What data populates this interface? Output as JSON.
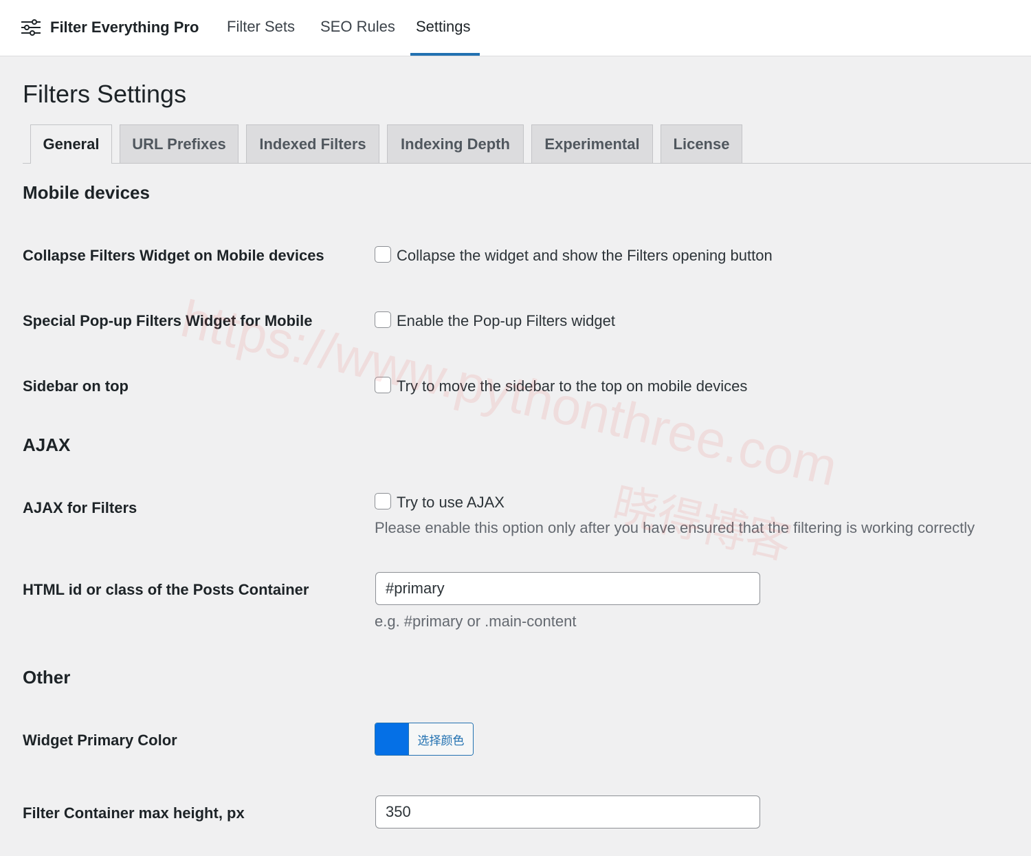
{
  "header": {
    "brand_name": "Filter Everything Pro",
    "brand_icon": "sliders-icon",
    "nav": [
      {
        "label": "Filter Sets",
        "active": false
      },
      {
        "label": "SEO Rules",
        "active": false
      },
      {
        "label": "Settings",
        "active": true
      }
    ],
    "accent_color": "#2271b1"
  },
  "page": {
    "title": "Filters Settings",
    "tabs": [
      {
        "label": "General",
        "active": true
      },
      {
        "label": "URL Prefixes",
        "active": false
      },
      {
        "label": "Indexed Filters",
        "active": false
      },
      {
        "label": "Indexing Depth",
        "active": false
      },
      {
        "label": "Experimental",
        "active": false
      },
      {
        "label": "License",
        "active": false
      }
    ]
  },
  "sections": {
    "mobile": {
      "title": "Mobile devices",
      "collapse": {
        "label": "Collapse Filters Widget on Mobile devices",
        "checkbox_label": "Collapse the widget and show the Filters opening button",
        "checked": false
      },
      "popup": {
        "label": "Special Pop-up Filters Widget for Mobile",
        "checkbox_label": "Enable the Pop-up Filters widget",
        "checked": false
      },
      "sidebar": {
        "label": "Sidebar on top",
        "checkbox_label": "Try to move the sidebar to the top on mobile devices",
        "checked": false
      }
    },
    "ajax": {
      "title": "AJAX",
      "ajax_filters": {
        "label": "AJAX for Filters",
        "checkbox_label": "Try to use AJAX",
        "checked": false,
        "description": "Please enable this option only after you have ensured that the filtering is working correctly"
      },
      "container": {
        "label": "HTML id or class of the Posts Container",
        "value": "#primary",
        "hint": "e.g. #primary or .main-content"
      }
    },
    "other": {
      "title": "Other",
      "primary_color": {
        "label": "Widget Primary Color",
        "button_label": "选择颜色",
        "color": "#0570e6"
      },
      "max_height": {
        "label": "Filter Container max height, px",
        "value": "350"
      }
    }
  },
  "watermark": {
    "url": "https://www.pythonthree.com",
    "cn": "晓得博客"
  }
}
